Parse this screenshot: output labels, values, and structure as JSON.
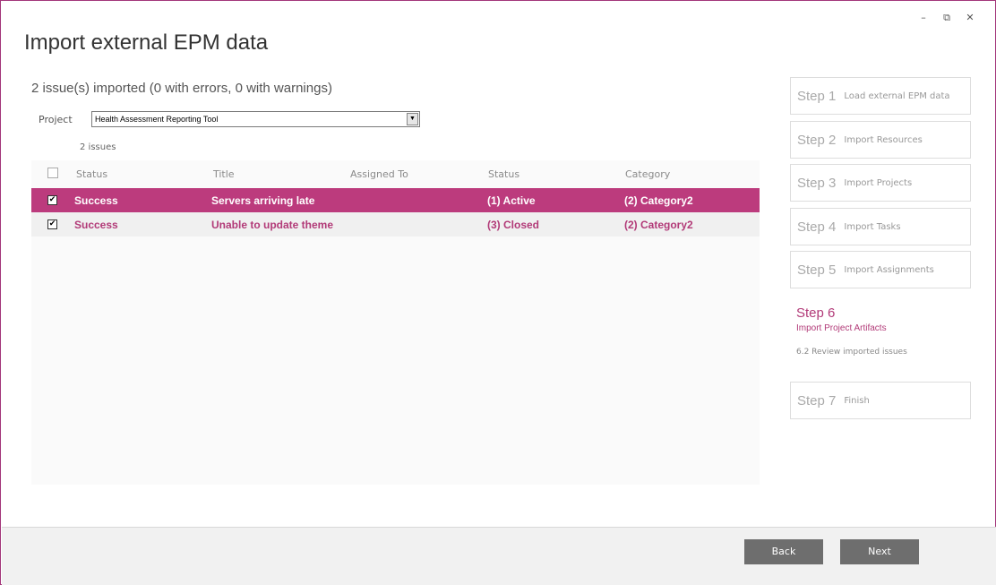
{
  "window": {
    "title": "Import external EPM data",
    "controls": {
      "minimize": "–",
      "restore": "⧉",
      "close": "✕"
    }
  },
  "summary": "2 issue(s) imported (0 with errors, 0 with warnings)",
  "project": {
    "label": "Project",
    "selected": "Health Assessment Reporting Tool",
    "arrow": "▼"
  },
  "issue_count": "2 issues",
  "table": {
    "headers": [
      "Status",
      "Title",
      "Assigned To",
      "Status",
      "Category"
    ],
    "rows": [
      {
        "checked": "✔",
        "status": "Success",
        "title": "Servers arriving late",
        "assigned_to": "",
        "state": "(1) Active",
        "category": "(2) Category2",
        "selected": true
      },
      {
        "checked": "✔",
        "status": "Success",
        "title": "Unable to update theme",
        "assigned_to": "",
        "state": "(3) Closed",
        "category": "(2) Category2",
        "selected": false
      }
    ]
  },
  "steps": [
    {
      "num": "Step 1",
      "name": "Load external EPM data"
    },
    {
      "num": "Step 2",
      "name": "Import Resources"
    },
    {
      "num": "Step 3",
      "name": "Import Projects"
    },
    {
      "num": "Step 4",
      "name": "Import Tasks"
    },
    {
      "num": "Step 5",
      "name": "Import Assignments"
    },
    {
      "num": "Step 6",
      "name": "Import Project Artifacts",
      "sub": "6.2 Review imported issues",
      "active": true
    },
    {
      "num": "Step 7",
      "name": "Finish"
    }
  ],
  "footer": {
    "back": "Back",
    "next": "Next"
  },
  "colors": {
    "accent": "#b23a78",
    "selected_row": "#bc3b7d",
    "button": "#6e6e6e",
    "border": "#a3367a"
  }
}
